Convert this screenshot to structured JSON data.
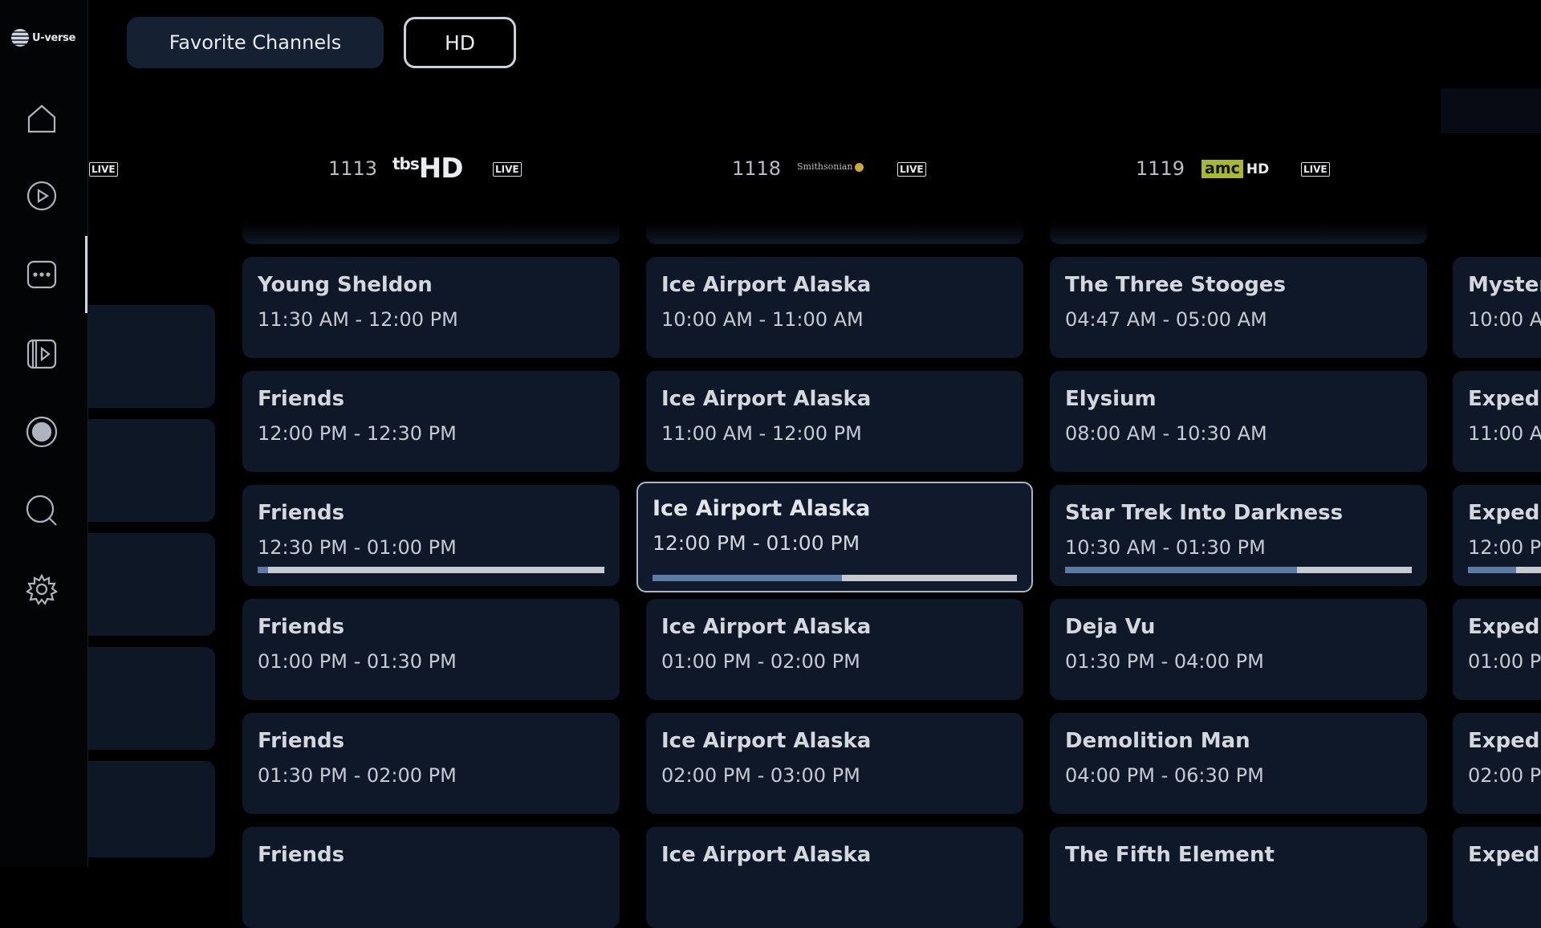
{
  "brand": {
    "name": "U-verse"
  },
  "filters": {
    "favorites_label": "Favorite Channels",
    "hd_label": "HD"
  },
  "nav": {
    "items": [
      {
        "icon": "home-icon"
      },
      {
        "icon": "play-icon"
      },
      {
        "icon": "more-icon"
      },
      {
        "icon": "library-icon"
      },
      {
        "icon": "record-icon"
      },
      {
        "icon": "search-icon"
      },
      {
        "icon": "settings-icon"
      }
    ]
  },
  "live_label": "LIVE",
  "channels": [
    {
      "number": "1113",
      "logo_text": "tbs",
      "logo_hd": "HD",
      "programs": [
        {
          "title": "Young Sheldon",
          "time": "11:30 AM - 12:00 PM"
        },
        {
          "title": "Friends",
          "time": "12:00 PM - 12:30 PM"
        },
        {
          "title": "Friends",
          "time": "12:30 PM - 01:00 PM",
          "progress": 0.03
        },
        {
          "title": "Friends",
          "time": "01:00 PM - 01:30 PM"
        },
        {
          "title": "Friends",
          "time": "01:30 PM - 02:00 PM"
        },
        {
          "title": "Friends",
          "time": ""
        }
      ]
    },
    {
      "number": "1118",
      "logo_text": "Smithsonian",
      "programs": [
        {
          "title": "Ice Airport Alaska",
          "time": "10:00 AM - 11:00 AM"
        },
        {
          "title": "Ice Airport Alaska",
          "time": "11:00 AM - 12:00 PM"
        },
        {
          "title": "Ice Airport Alaska",
          "time": "12:00 PM - 01:00 PM",
          "progress": 0.52,
          "selected": true
        },
        {
          "title": "Ice Airport Alaska",
          "time": "01:00 PM - 02:00 PM"
        },
        {
          "title": "Ice Airport Alaska",
          "time": "02:00 PM - 03:00 PM"
        },
        {
          "title": "Ice Airport Alaska",
          "time": ""
        }
      ]
    },
    {
      "number": "1119",
      "logo_text": "amc",
      "logo_hd": "HD",
      "programs": [
        {
          "title": "The Three Stooges",
          "time": "04:47 AM - 05:00 AM"
        },
        {
          "title": "Elysium",
          "time": "08:00 AM - 10:30 AM"
        },
        {
          "title": "Star Trek Into Darkness",
          "time": "10:30 AM - 01:30 PM",
          "progress": 0.67
        },
        {
          "title": "Deja Vu",
          "time": "01:30 PM - 04:00 PM"
        },
        {
          "title": "Demolition Man",
          "time": "04:00 PM - 06:30 PM"
        },
        {
          "title": "The Fifth Element",
          "time": ""
        }
      ]
    },
    {
      "programs": [
        {
          "title": "Myster",
          "time": "10:00 Al"
        },
        {
          "title": "Expedi",
          "time": "11:00 AN"
        },
        {
          "title": "Expedi",
          "time": "12:00 PI",
          "progress": 0.6
        },
        {
          "title": "Expedi",
          "time": "01:00 PI"
        },
        {
          "title": "Expedi",
          "time": "02:00 PI"
        },
        {
          "title": "Expedi",
          "time": ""
        }
      ]
    }
  ],
  "colors": {
    "accent_progress": "#5c7aa3",
    "tile_bg": "#0f1828",
    "amc_brand": "#a9b832"
  }
}
